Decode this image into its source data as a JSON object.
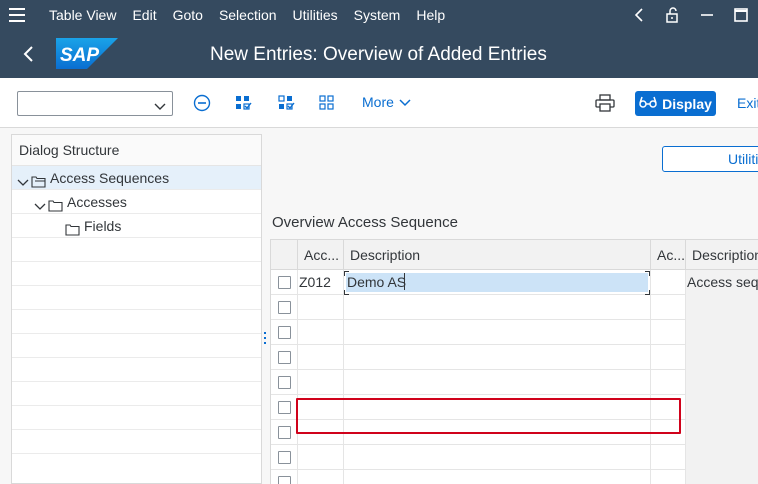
{
  "menu": {
    "items": [
      "Table View",
      "Edit",
      "Goto",
      "Selection",
      "Utilities",
      "System",
      "Help"
    ]
  },
  "icons": {
    "menu": "hamburger-icon",
    "back": "chevron-left-icon",
    "lock": "unlock-icon",
    "minimize": "minimize-icon",
    "maximize": "maximize-icon",
    "dropdown": "chevron-down-icon",
    "collapse": "minus-circle-icon",
    "select_all": "select-all-icon",
    "select_block": "select-block-icon",
    "deselect_all": "deselect-all-icon",
    "print": "printer-icon",
    "display": "glasses-icon"
  },
  "logo": {
    "text": "SAP"
  },
  "title": "New Entries: Overview of Added Entries",
  "toolbar": {
    "command_value": "",
    "more_label": "More",
    "display_label": "Display",
    "exit_label": "Exit"
  },
  "dialog_structure": {
    "header": "Dialog Structure",
    "nodes": [
      {
        "label": "Access Sequences",
        "selected": true
      },
      {
        "label": "Accesses",
        "selected": false
      },
      {
        "label": "Fields",
        "selected": false
      }
    ]
  },
  "utilities_button": "Utiliti",
  "section_title": "Overview Access Sequence",
  "table": {
    "columns": [
      "Acc...",
      "Description",
      "Ac...",
      "Description"
    ],
    "rows": [
      {
        "acc": "Z012",
        "description": "Demo AS",
        "ac": "",
        "description2": "Access sequ"
      },
      {
        "acc": "",
        "description": "",
        "ac": "",
        "description2": ""
      },
      {
        "acc": "",
        "description": "",
        "ac": "",
        "description2": ""
      },
      {
        "acc": "",
        "description": "",
        "ac": "",
        "description2": ""
      },
      {
        "acc": "",
        "description": "",
        "ac": "",
        "description2": ""
      },
      {
        "acc": "",
        "description": "",
        "ac": "",
        "description2": ""
      },
      {
        "acc": "",
        "description": "",
        "ac": "",
        "description2": ""
      },
      {
        "acc": "",
        "description": "",
        "ac": "",
        "description2": ""
      },
      {
        "acc": "",
        "description": "",
        "ac": "",
        "description2": ""
      }
    ]
  },
  "colors": {
    "shell": "#354a5f",
    "accent": "#0a6ed1",
    "highlight": "#d0021b",
    "selection": "#cce3f7"
  }
}
